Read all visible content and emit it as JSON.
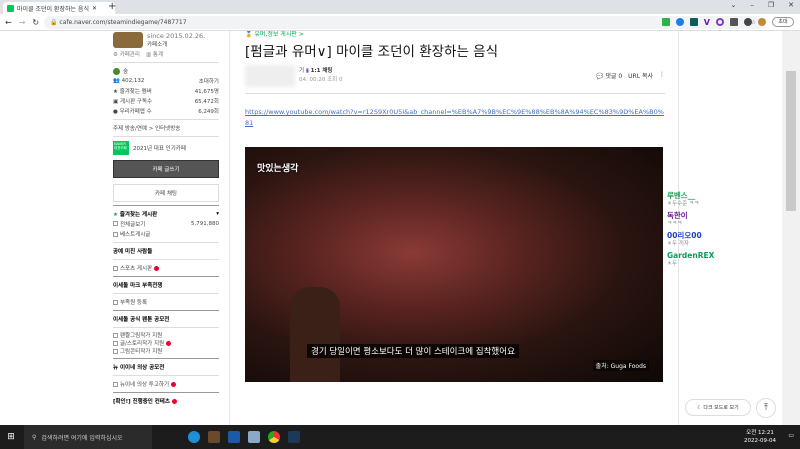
{
  "browser": {
    "tab_title": "마이클 조던이 환장하는 음식",
    "url": "cafe.naver.com/steamindiegame/7487717",
    "profile_label": "초대"
  },
  "sidebar": {
    "since": "since 2015.02.26.",
    "cafe_intro": "카페소개",
    "manage": "카페관리",
    "stats": "통계",
    "level": "숲",
    "members": "402,132",
    "invite": "초대하기",
    "stats_rows": [
      {
        "label": "즐겨찾는 멤버",
        "value": "41,675명"
      },
      {
        "label": "게시판 구독수",
        "value": "65,472회"
      },
      {
        "label": "우리카페앱 수",
        "value": "6,249회"
      }
    ],
    "topic": "주제 방송/연예 > 인터넷방송",
    "award": "2021년 대표 인기카페",
    "award_badge": "NAVER 대표카페",
    "write_button": "카페 글쓰기",
    "chat_button": "카페 채팅",
    "favorites": "즐겨찾는 게시판",
    "all_posts": "전체글보기",
    "all_count": "5,791,880",
    "best": "베스트게시글",
    "sections": [
      {
        "title": "공예 미친 사람들",
        "items": [
          "스포츠 게시판"
        ]
      },
      {
        "title": "이세돌 마크 부족전쟁",
        "items": [
          "부족원 등록"
        ]
      },
      {
        "title": "이세돌 공식 팬툰 공모전",
        "items": [
          "팬짤그림작가 지원",
          "글/스토리작가 지원",
          "그림콘티작가 지원"
        ]
      },
      {
        "title": "뉴 이이네 의상 공모전",
        "items": [
          "뉴이네 의상 투고하기"
        ]
      }
    ],
    "cut_off": "[확인!] 진행중인 컨테츠"
  },
  "post": {
    "board": "유머,정보 게시판 >",
    "title": "[펌글과 유머∨] 마이클 조던이 환장하는 음식",
    "author_suffix": "기",
    "badge": "1:1 채팅",
    "date": "04. 00:20",
    "views": "조회 0",
    "comments": "댓글 0",
    "url_copy": "URL 복사",
    "link": "https://www.youtube.com/watch?v=r12S9Xr0U5I&ab_channel=%EB%A7%9B%EC%9E%88%EB%8A%94%EC%83%9D%EA%B0%81",
    "video": {
      "title": "맛있는생각",
      "caption": "경기 당일이면 평소보다도 더 많이 스테이크에 집착했어요",
      "source": "출처: Guga Foods"
    }
  },
  "chat": [
    {
      "name": "루벤스__",
      "msg": "ㅊ두수준 ㅋㅋ",
      "color": "#1aa35c"
    },
    {
      "name": "독한이",
      "msg": "ㅋㅋㅋ",
      "color": "#6a1b9a"
    },
    {
      "name": "00리오00",
      "msg": "ㅊ두 끼자",
      "color": "#1e40c8"
    },
    {
      "name": "GardenREX",
      "msg": "ㅊ두",
      "color": "#0a9e5a"
    }
  ],
  "floating": {
    "dark_mode": "다크 모드로 보기"
  },
  "taskbar": {
    "search_placeholder": "검색하려면 여기에 입력하십시오",
    "time": "오전 12:21",
    "date": "2022-09-04"
  }
}
